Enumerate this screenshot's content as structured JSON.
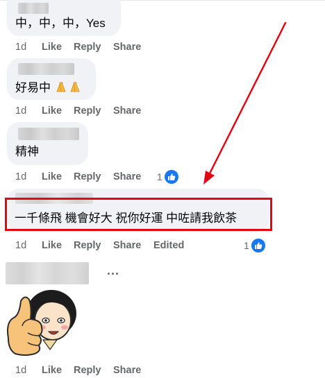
{
  "comments": [
    {
      "text": "中，中，中，Yes",
      "time": "1d",
      "like": "Like",
      "reply": "Reply",
      "share": "Share"
    },
    {
      "text": "好易中",
      "emoji_icon": "folded-hands-icon",
      "time": "1d",
      "like": "Like",
      "reply": "Reply",
      "share": "Share"
    },
    {
      "text": "精神",
      "time": "1d",
      "like": "Like",
      "reply": "Reply",
      "share": "Share",
      "reaction_count": "1"
    },
    {
      "text": "一千條飛 機會好大 祝你好運 中咗請我飲茶",
      "time": "1d",
      "like": "Like",
      "reply": "Reply",
      "share": "Share",
      "edited": "Edited",
      "reaction_count": "1"
    },
    {
      "sticker": "thumbs-up-girl-sticker",
      "more": "...",
      "time": "1d",
      "like": "Like",
      "reply": "Reply",
      "share": "Share"
    }
  ],
  "annotation": {
    "box_color": "#e30613",
    "arrow_color": "#e30613"
  },
  "colors": {
    "bubble": "#f0f2f5",
    "meta": "#65676b",
    "like_blue": "#1877f2"
  }
}
